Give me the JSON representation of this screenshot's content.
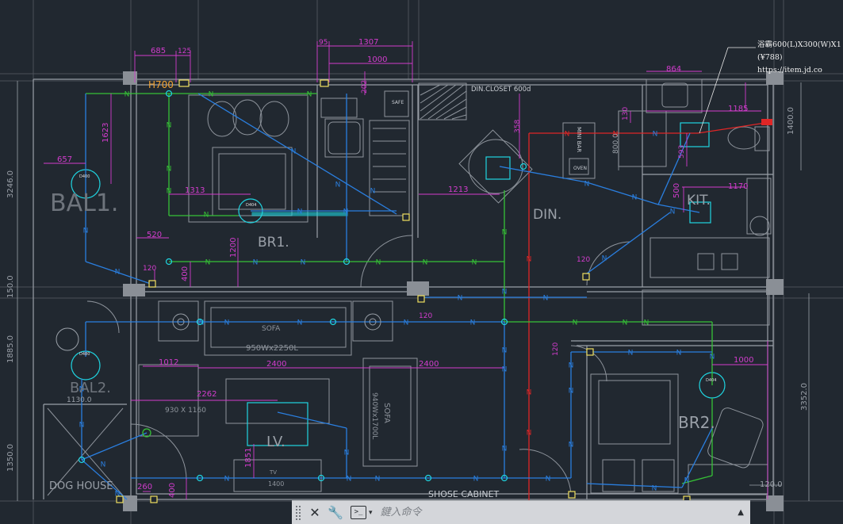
{
  "rooms": {
    "bal1": "BAL1.",
    "bal2": "BAL2.",
    "br1": "BR1.",
    "br2": "BR2.",
    "din": "DIN.",
    "kit": "KIT.",
    "lv": "LV.",
    "dog_house": "DOG HOUSE",
    "shoe_cabinet": "SHOSE CABINET",
    "din_closet": "DIN.CLOSET 600d",
    "h700": "H700",
    "safe": "SAFE",
    "mini_bar": "MINI BAR",
    "oven": "OVEN",
    "sofa1": "SOFA",
    "sofa1_size": "950Wx2250L",
    "sofa2": "SOFA",
    "sofa2_size": "940Wx1700L",
    "chair_size": "930 X 1160",
    "tv": "TV",
    "tv_size": "1400"
  },
  "lamps": {
    "lamp1": "D400",
    "lamp2": "D404",
    "lamp3": "D480",
    "lamp4": "D404"
  },
  "dimensions": {
    "d685": "685",
    "d125": "125",
    "d95": "95",
    "d1307": "1307",
    "d1000a": "1000",
    "d1623": "1623",
    "d657": "657",
    "d1313": "1313",
    "d1213": "1213",
    "d520": "520",
    "d1200": "1200",
    "d400a": "400",
    "d120a": "120",
    "d2400a": "2400",
    "d2400b": "2400",
    "d1012": "1012",
    "d2262": "2262",
    "d1130": "1130.0",
    "d260": "260",
    "d400b": "400",
    "d1851": "1851",
    "d864": "864",
    "d1185": "1185",
    "d1170": "1170",
    "d500": "500",
    "d593": "593",
    "d130": "130",
    "d800": "800.0",
    "d1400": "1400.0",
    "d1000b": "1000",
    "d3352": "3352.0",
    "d120b": "120.0",
    "d3246": "3246.0",
    "d150": "150.0",
    "d1885": "1885.0",
    "d1350": "1350.0",
    "d120c": "120",
    "d120d": "120",
    "d120e": "120",
    "d202": "202",
    "d358": "358"
  },
  "tooltip": {
    "line1": "浴霸600(L)X300(W)X1",
    "line2": "(¥788)",
    "line3": "https://item.jd.co"
  },
  "command_line": {
    "close_icon": "close-icon",
    "settings_icon": "wrench-icon",
    "prompt_icon": "command-prompt-icon",
    "prompt_glyph": ">_",
    "placeholder": "鍵入命令"
  },
  "colors": {
    "background": "#212830",
    "wall": "#8a909a",
    "dimension": "#d23ccd",
    "wire_blue": "#2a7fe0",
    "wire_green": "#36c236",
    "wire_red": "#e02626",
    "fixture_cyan": "#1fd4e0",
    "orange_label": "#f0a030"
  }
}
